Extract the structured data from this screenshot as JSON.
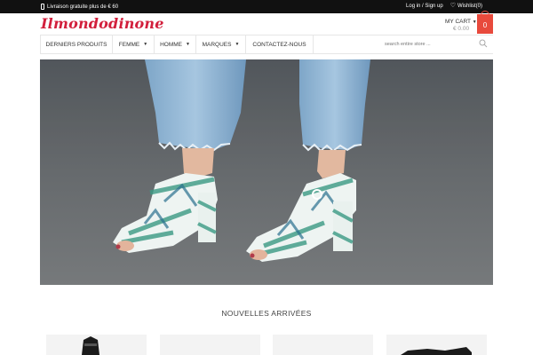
{
  "topbar": {
    "shipping_text": "Livraison gratuite plus de € 60",
    "login_text": "Log in / Sign up",
    "wishlist_text": "Wishlist(0)"
  },
  "header": {
    "logo_text": "Ilmondodinone",
    "cart_label": "MY CART",
    "cart_total": "€ 0.00",
    "cart_count": "0"
  },
  "nav": {
    "items": [
      {
        "label": "DERNIERS PRODUITS"
      },
      {
        "label": "FEMME"
      },
      {
        "label": "HOMME"
      },
      {
        "label": "MARQUES"
      },
      {
        "label": "CONTACTEZ-NOUS"
      }
    ],
    "search_placeholder": "search entire store ..."
  },
  "section": {
    "title": "NOUVELLES ARRIVÉES"
  },
  "colors": {
    "accent": "#e84a3c",
    "logo": "#d21f3c",
    "topbar": "#111111"
  }
}
